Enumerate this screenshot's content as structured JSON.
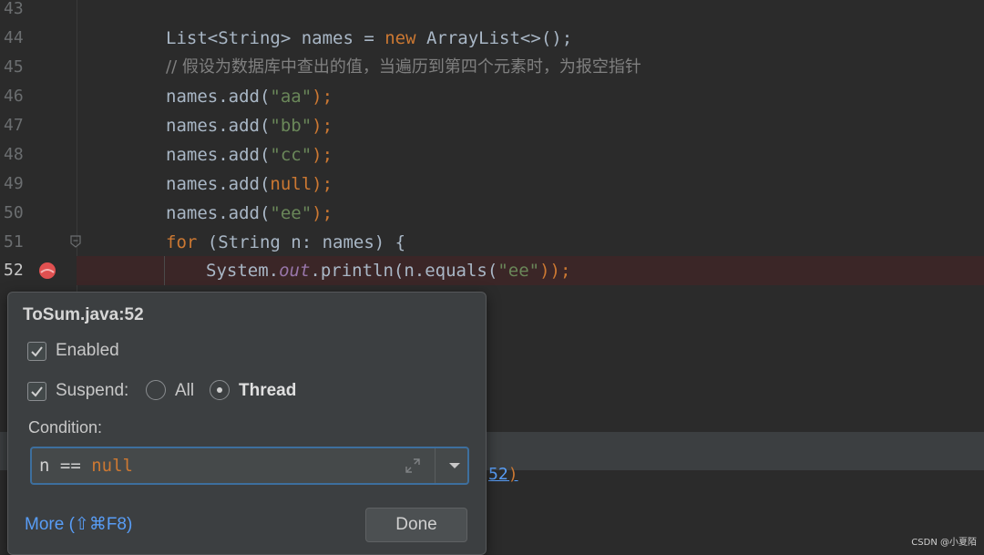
{
  "editor": {
    "line_numbers": [
      "43",
      "44",
      "45",
      "46",
      "47",
      "48",
      "49",
      "50",
      "51",
      "52"
    ],
    "lines": {
      "l44": {
        "a": "List<String> names = ",
        "b": "new ",
        "c": "ArrayList<>();"
      },
      "l45": "// 假设为数据库中查出的值，当遍历到第四个元素时，为报空指针",
      "l46": {
        "a": "names.add(",
        "b": "\"aa\"",
        "c": ");"
      },
      "l47": {
        "a": "names.add(",
        "b": "\"bb\"",
        "c": ");"
      },
      "l48": {
        "a": "names.add(",
        "b": "\"cc\"",
        "c": ");"
      },
      "l49": {
        "a": "names.add(",
        "b": "null",
        "c": ");"
      },
      "l50": {
        "a": "names.add(",
        "b": "\"ee\"",
        "c": ");"
      },
      "l51": {
        "kw": "for ",
        "a": "(String n: names) {"
      },
      "l52": {
        "a": "System.",
        "f": "out",
        "b": ".println(n.equals(",
        "s": "\"ee\"",
        "c": "));"
      }
    },
    "breakpoint_line": "52"
  },
  "bottom_panel": {
    "link_text": "52",
    "paren": ")"
  },
  "popup": {
    "title": "ToSum.java:52",
    "enabled_label": "Enabled",
    "enabled_checked": true,
    "suspend_label": "Suspend:",
    "suspend_checked": true,
    "radio_all_label": "All",
    "radio_thread_label": "Thread",
    "selected_radio": "Thread",
    "condition_label": "Condition:",
    "condition_value": {
      "a": "n == ",
      "b": "null"
    },
    "more_label": "More (⇧⌘F8)",
    "done_label": "Done"
  },
  "watermark": "CSDN @小夏陌",
  "colors": {
    "keyword": "#cc7832",
    "string": "#6a8759",
    "link": "#589df6",
    "breakpoint": "#e05050"
  }
}
